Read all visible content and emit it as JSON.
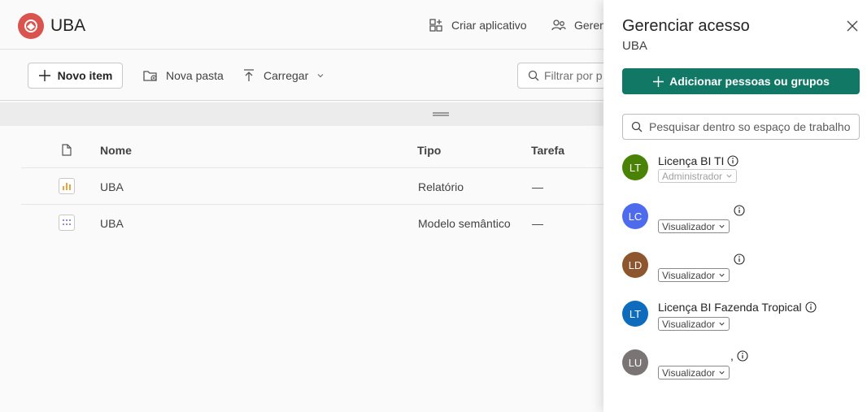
{
  "workspace": {
    "name": "UBA",
    "header": {
      "create_app_label": "Criar aplicativo",
      "manage_label_partial": "Geren"
    },
    "toolbar": {
      "new_item_label": "Novo item",
      "new_folder_label": "Nova pasta",
      "upload_label": "Carregar",
      "filter_placeholder": "Filtrar por p"
    },
    "table": {
      "columns": [
        "Nome",
        "Tipo",
        "Tarefa"
      ],
      "rows": [
        {
          "name": "UBA",
          "type": "Relatório",
          "task": "—",
          "icon": "report-icon"
        },
        {
          "name": "UBA",
          "type": "Modelo semântico",
          "task": "—",
          "icon": "semantic-model-icon"
        }
      ]
    }
  },
  "panel": {
    "title": "Gerenciar acesso",
    "subtitle": "UBA",
    "add_button_label": "Adicionar pessoas ou grupos",
    "search_placeholder": "Pesquisar dentro so espaço de trabalho",
    "people": [
      {
        "initials": "LT",
        "name": "Licença BI TI",
        "role": "Administrador",
        "role_disabled": true,
        "color": "#498205"
      },
      {
        "initials": "LC",
        "name": "",
        "role": "Visualizador",
        "role_disabled": false,
        "color": "#4f6bed"
      },
      {
        "initials": "LD",
        "name": "",
        "role": "Visualizador",
        "role_disabled": false,
        "color": "#8e562e"
      },
      {
        "initials": "LT",
        "name": "Licença BI Fazenda Tropical",
        "role": "Visualizador",
        "role_disabled": false,
        "color": "#0f6cbd"
      },
      {
        "initials": "LU",
        "name": ",",
        "role": "Visualizador",
        "role_disabled": false,
        "color": "#7a7574"
      }
    ]
  },
  "colors": {
    "accent_green": "#117865",
    "logo_red": "#d9534f"
  }
}
